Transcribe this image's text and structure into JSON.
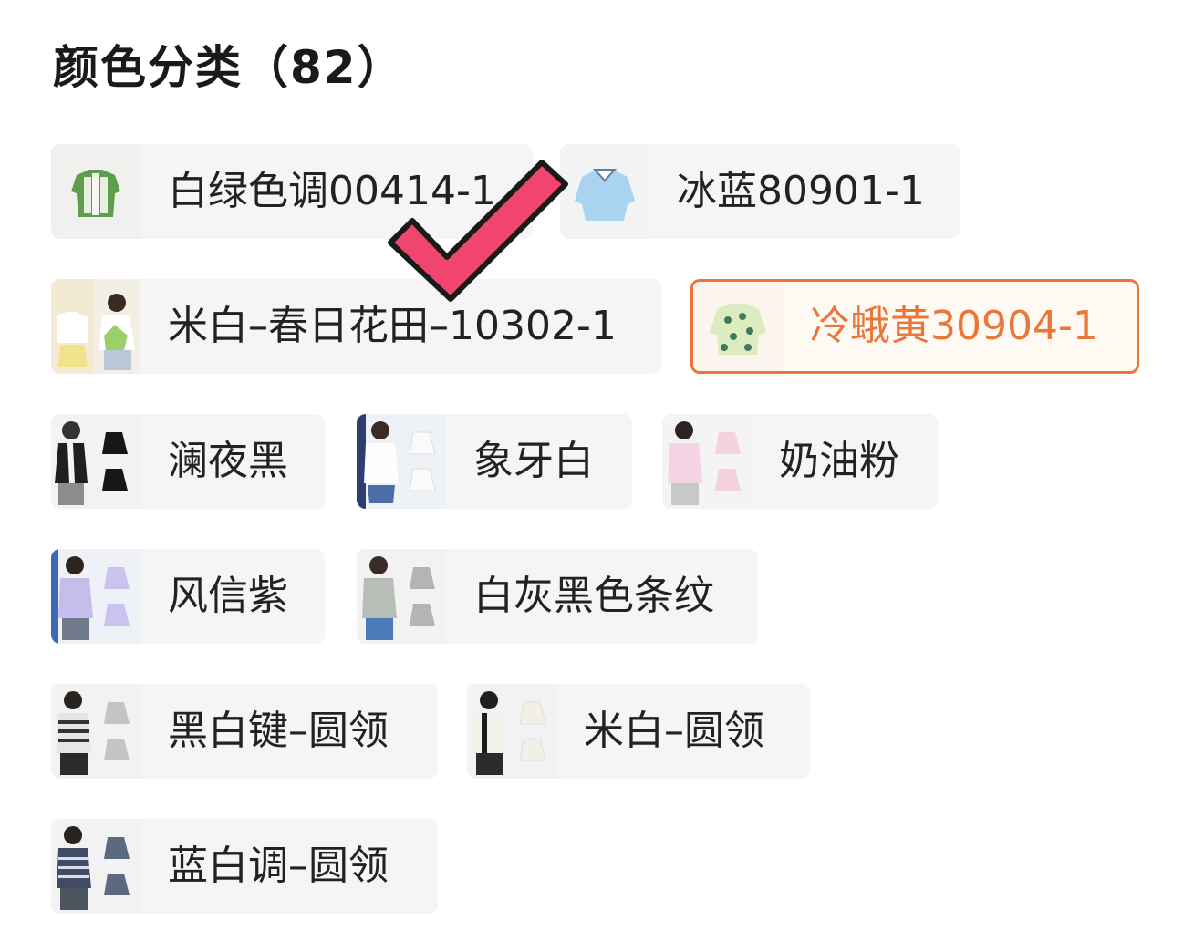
{
  "section": {
    "title": "颜色分类（82）"
  },
  "colors": {
    "accent": "#e9773a",
    "chip_background": "#f5f5f6",
    "check_mark": "#f0456e"
  },
  "options": [
    {
      "label": "白绿色调00414-1",
      "selected": false
    },
    {
      "label": "冰蓝80901-1",
      "selected": false
    },
    {
      "label": "米白–春日花田–10302-1",
      "selected": false
    },
    {
      "label": "冷蛾黄30904-1",
      "selected": true
    },
    {
      "label": "澜夜黑",
      "selected": false
    },
    {
      "label": "象牙白",
      "selected": false
    },
    {
      "label": "奶油粉",
      "selected": false
    },
    {
      "label": "风信紫",
      "selected": false
    },
    {
      "label": "白灰黑色条纹",
      "selected": false
    },
    {
      "label": "黑白键–圆领",
      "selected": false
    },
    {
      "label": "米白–圆领",
      "selected": false
    },
    {
      "label": "蓝白调–圆领",
      "selected": false
    }
  ]
}
